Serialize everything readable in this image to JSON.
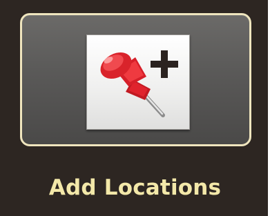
{
  "button": {
    "label": "Add Locations",
    "icon": "add-location-pushpin-icon"
  },
  "colors": {
    "background": "#2d2622",
    "button_border": "#efe5be",
    "label_text": "#f3e8a9",
    "pin_red": "#e0232d",
    "plus_sign": "#2b2320"
  }
}
